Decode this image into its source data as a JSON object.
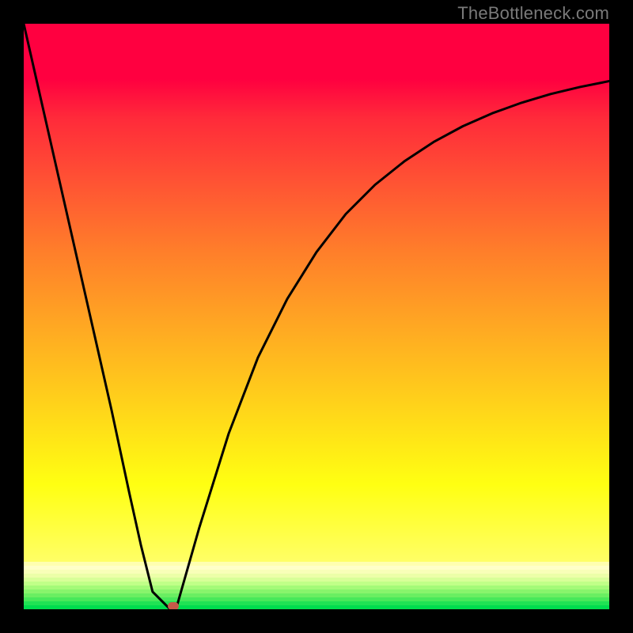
{
  "watermark": "TheBottleneck.com",
  "colors": {
    "accent_red": "#ff0040",
    "accent_green": "#00e060",
    "marker": "#c65a48",
    "curve": "#000000"
  },
  "chart_data": {
    "type": "line",
    "title": "",
    "xlabel": "",
    "ylabel": "",
    "xlim": [
      0,
      100
    ],
    "ylim": [
      0,
      100
    ],
    "series": [
      {
        "name": "bottleneck-curve",
        "x": [
          0,
          5,
          10,
          15,
          18,
          20,
          22,
          25,
          26,
          30,
          35,
          40,
          45,
          50,
          55,
          60,
          65,
          70,
          75,
          80,
          85,
          90,
          95,
          100
        ],
        "y": [
          100,
          78,
          56,
          34,
          20,
          11,
          3,
          0,
          0,
          14,
          30,
          43,
          53,
          61,
          67.5,
          72.5,
          76.5,
          79.8,
          82.5,
          84.7,
          86.5,
          88,
          89.2,
          90.2
        ]
      }
    ],
    "marker": {
      "x": 25.5,
      "y": 0.5
    },
    "bottom_stripes_top_to_bottom": [
      "#ffffb0",
      "#ffffc8",
      "#f8ffb8",
      "#ecffa8",
      "#d8ff98",
      "#c0ff88",
      "#a4fa78",
      "#88f46c",
      "#6aee62",
      "#48e85a",
      "#20e254",
      "#00dc4e"
    ]
  }
}
